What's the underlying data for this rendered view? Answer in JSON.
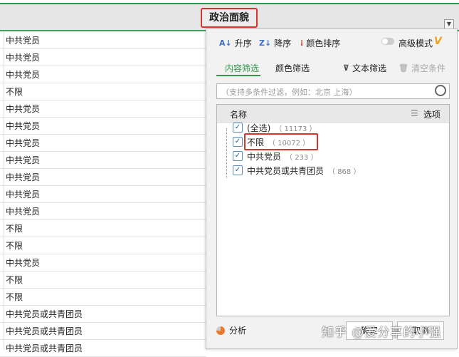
{
  "column_header": {
    "title": "政治面貌"
  },
  "rows": [
    "中共党员",
    "中共党员",
    "中共党员",
    "不限",
    "中共党员",
    "中共党员",
    "中共党员",
    "中共党员",
    "中共党员",
    "中共党员",
    "中共党员",
    "不限",
    "不限",
    "中共党员",
    "不限",
    "不限",
    "中共党员或共青团员",
    "中共党员或共青团员",
    "中共党员或共青团员"
  ],
  "filter": {
    "toolbar": {
      "asc": "升序",
      "desc": "降序",
      "color_sort": "颜色排序",
      "advanced": "高级模式"
    },
    "tabs": {
      "content": "内容筛选",
      "color": "颜色筛选"
    },
    "text_filter": "文本筛选",
    "clear": "清空条件",
    "search_placeholder": "（支持多条件过滤，例如：北京 上海）",
    "list_header": {
      "name": "名称",
      "options": "选项"
    },
    "items": [
      {
        "label": "(全选)",
        "count": "（ 11173 ）",
        "checked": true
      },
      {
        "label": "不限",
        "count": "（ 10072 ）",
        "checked": true
      },
      {
        "label": "中共党员",
        "count": "（ 233 ）",
        "checked": true
      },
      {
        "label": "中共党员或共青团员",
        "count": "（ 868 ）",
        "checked": true
      }
    ],
    "analyze": "分析",
    "ok": "确定",
    "cancel": "取消"
  },
  "watermark": "知乎 @爱分享的小强",
  "colors": {
    "accent": "#2e9a4a",
    "highlight": "#d9342b"
  }
}
